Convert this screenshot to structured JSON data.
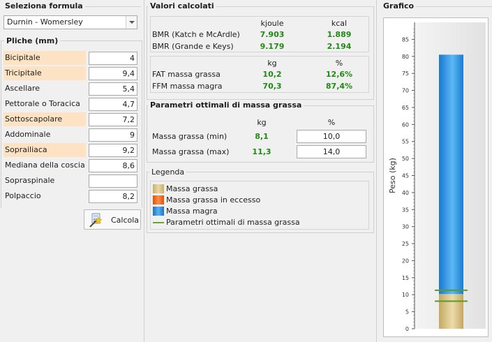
{
  "formula": {
    "title": "Seleziona formula",
    "selected": "Durnin - Womersley"
  },
  "pliche": {
    "title": "Pliche (mm)",
    "items": [
      {
        "label": "Bicipitale",
        "value": "4",
        "highlight": true
      },
      {
        "label": "Tricipitale",
        "value": "9,4",
        "highlight": true
      },
      {
        "label": "Ascellare",
        "value": "5,4",
        "highlight": false
      },
      {
        "label": "Pettorale o Toracica",
        "value": "4,7",
        "highlight": false
      },
      {
        "label": "Sottoscapolare",
        "value": "7,2",
        "highlight": true
      },
      {
        "label": "Addominale",
        "value": "9",
        "highlight": false
      },
      {
        "label": "Soprailiaca",
        "value": "9,2",
        "highlight": true
      },
      {
        "label": "Mediana della coscia",
        "value": "8,6",
        "highlight": false
      },
      {
        "label": "Sopraspinale",
        "value": "",
        "highlight": false
      },
      {
        "label": "Polpaccio",
        "value": "8,2",
        "highlight": false
      }
    ],
    "calc_label": "Calcola"
  },
  "valori": {
    "title": "Valori calcolati",
    "bmr": {
      "col1": "kjoule",
      "col2": "kcal",
      "rows": [
        {
          "label": "BMR (Katch e McArdle)",
          "v1": "7.903",
          "v2": "1.889"
        },
        {
          "label": "BMR (Grande e Keys)",
          "v1": "9.179",
          "v2": "2.194"
        }
      ]
    },
    "comp": {
      "col1": "kg",
      "col2": "%",
      "rows": [
        {
          "label": "FAT massa grassa",
          "v1": "10,2",
          "v2": "12,6%"
        },
        {
          "label": "FFM massa magra",
          "v1": "70,3",
          "v2": "87,4%"
        }
      ]
    }
  },
  "parametri": {
    "title": "Parametri ottimali di massa grassa",
    "col1": "kg",
    "col2": "%",
    "rows": [
      {
        "label": "Massa grassa (min)",
        "kg": "8,1",
        "pct": "10,0"
      },
      {
        "label": "Massa grassa (max)",
        "kg": "11,3",
        "pct": "14,0"
      }
    ]
  },
  "legenda": {
    "title": "Legenda",
    "items": [
      {
        "label": "Massa grassa",
        "color": "#d8c28a",
        "kind": "grassa"
      },
      {
        "label": "Massa grassa in eccesso",
        "color": "#f26a1b",
        "kind": "eccesso"
      },
      {
        "label": "Massa magra",
        "color": "#2b8fde",
        "kind": "magra"
      },
      {
        "label": "Parametri ottimali di massa grassa",
        "color": "#6aa33a",
        "kind": "line"
      }
    ]
  },
  "grafico": {
    "title": "Grafico"
  },
  "chart_data": {
    "type": "bar",
    "categories": [
      ""
    ],
    "series": [
      {
        "name": "Massa grassa",
        "values": [
          10.2
        ]
      },
      {
        "name": "Massa magra",
        "values": [
          70.3
        ]
      }
    ],
    "reference_lines": [
      8.1,
      11.3
    ],
    "ylabel": "Peso (kg)",
    "ylim": [
      0,
      90
    ],
    "yticks": [
      0,
      5,
      10,
      15,
      20,
      25,
      30,
      35,
      40,
      45,
      50,
      55,
      60,
      65,
      70,
      75,
      80,
      85
    ],
    "stacked": true,
    "grid": false,
    "colors": {
      "grassa": "#d8c28a",
      "magra": "#2b8fde",
      "line": "#5a9a2a"
    }
  }
}
